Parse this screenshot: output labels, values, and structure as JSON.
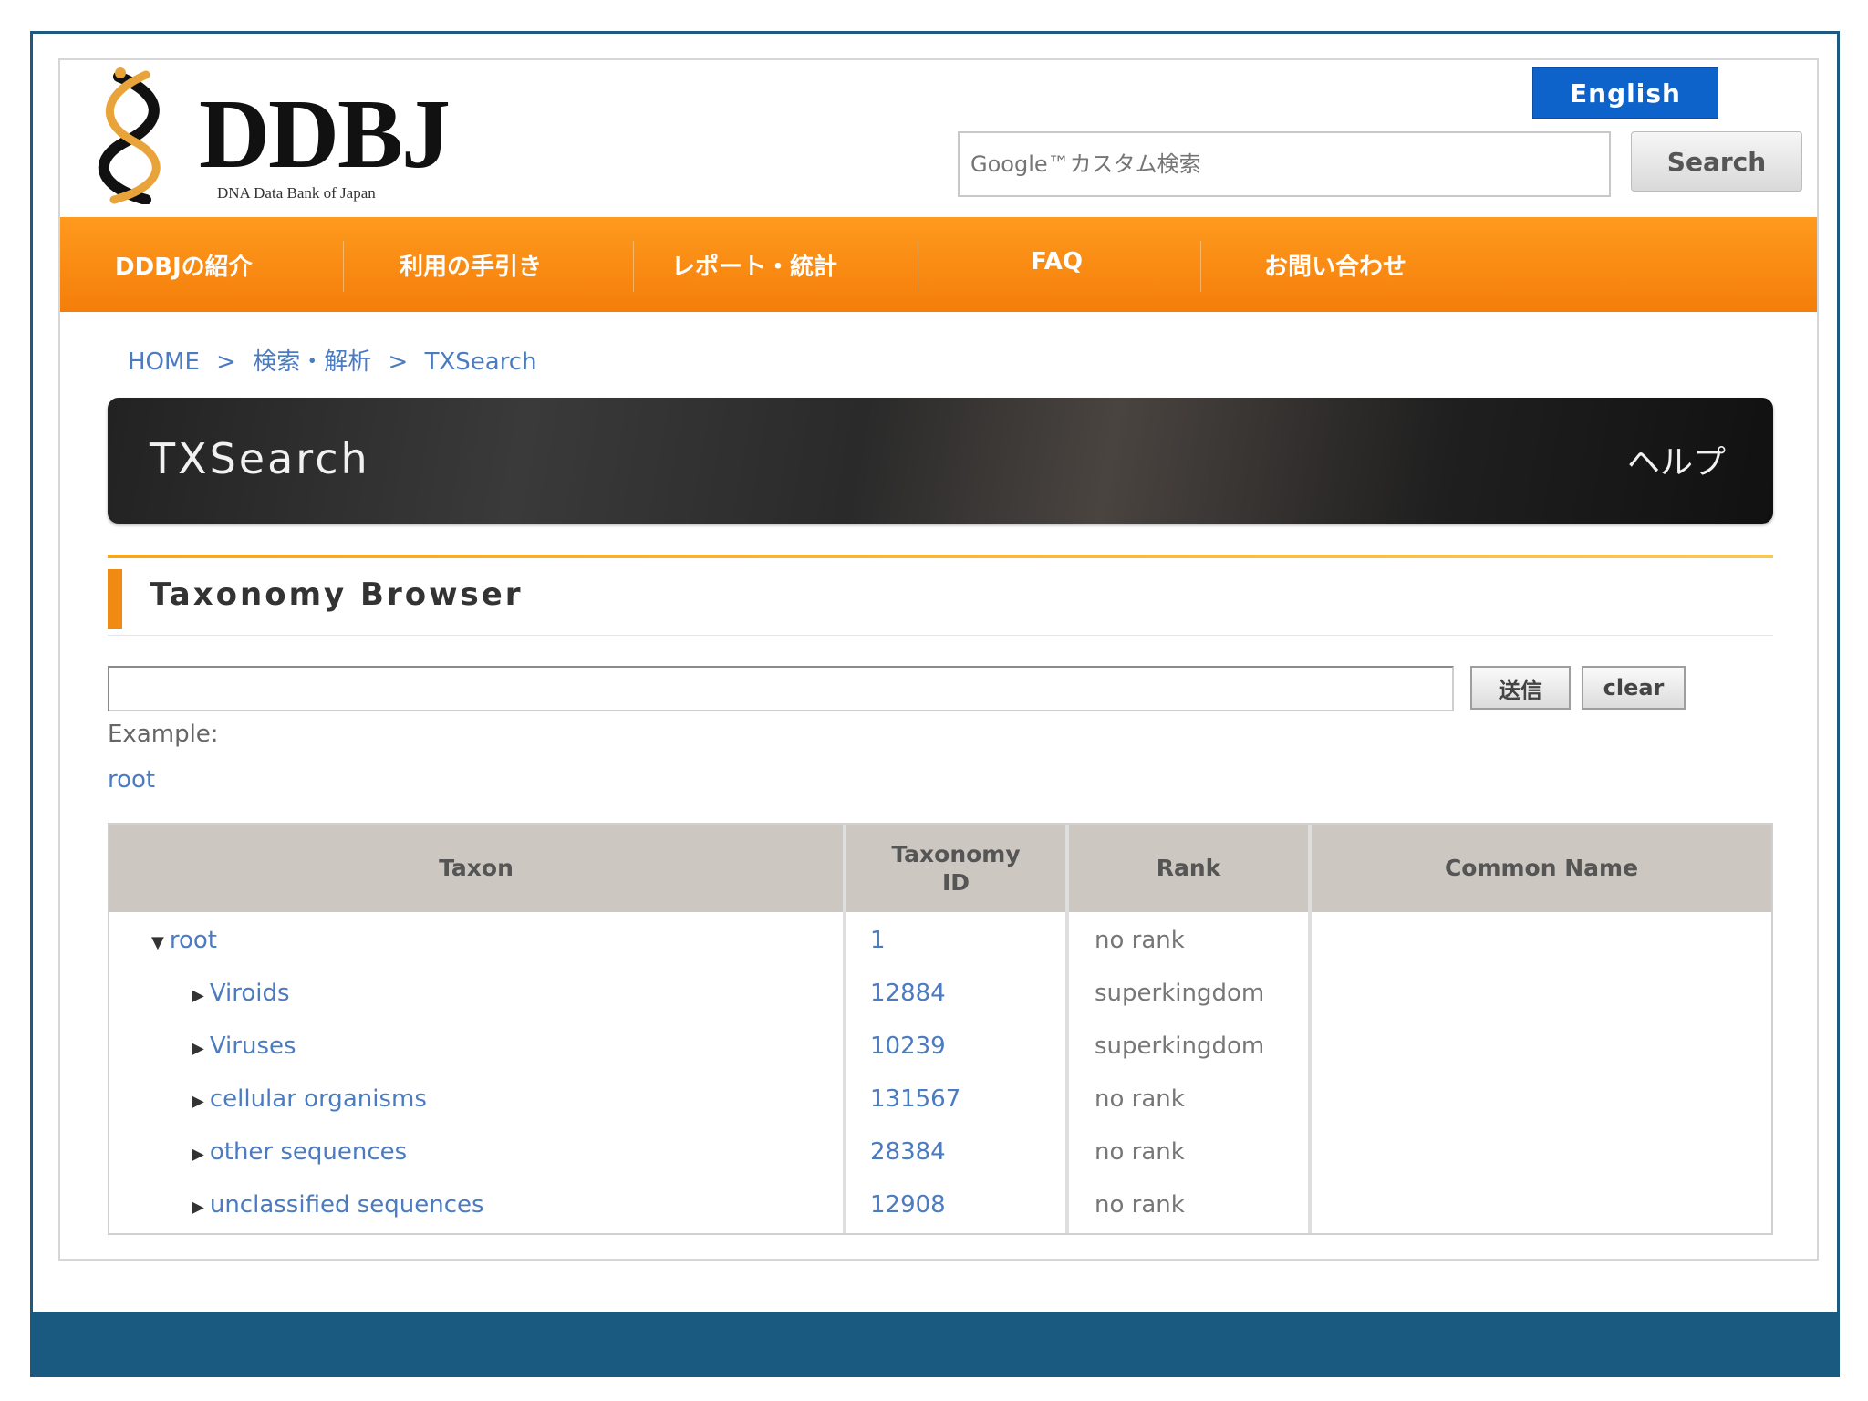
{
  "header": {
    "logo_text": "DDBJ",
    "logo_subtitle": "DNA Data Bank of Japan",
    "english_label": "English",
    "search_placeholder": "Google™カスタム検索",
    "search_button": "Search"
  },
  "nav": {
    "items": [
      {
        "label": "DDBJの紹介"
      },
      {
        "label": "利用の手引き"
      },
      {
        "label": "レポート・統計"
      },
      {
        "label": "FAQ"
      },
      {
        "label": "お問い合わせ"
      }
    ]
  },
  "breadcrumb": {
    "items": [
      "HOME",
      ">",
      "検索・解析",
      ">",
      "TXSearch"
    ]
  },
  "banner": {
    "title": "TXSearch",
    "help": "ヘルプ"
  },
  "section": {
    "title": "Taxonomy Browser"
  },
  "form": {
    "query_value": "",
    "submit_label": "送信",
    "clear_label": "clear",
    "example_label": "Example:",
    "example_link": "root"
  },
  "table": {
    "headers": {
      "taxon": "Taxon",
      "taxonomy_id_line1": "Taxonomy",
      "taxonomy_id_line2": "ID",
      "rank": "Rank",
      "common_name": "Common Name"
    },
    "rows": [
      {
        "taxon": "root",
        "id": "1",
        "rank": "no rank",
        "common_name": ""
      },
      {
        "taxon": "Viroids",
        "id": "12884",
        "rank": "superkingdom",
        "common_name": ""
      },
      {
        "taxon": "Viruses",
        "id": "10239",
        "rank": "superkingdom",
        "common_name": ""
      },
      {
        "taxon": "cellular organisms",
        "id": "131567",
        "rank": "no rank",
        "common_name": ""
      },
      {
        "taxon": "other sequences",
        "id": "28384",
        "rank": "no rank",
        "common_name": ""
      },
      {
        "taxon": "unclassified sequences",
        "id": "12908",
        "rank": "no rank",
        "common_name": ""
      }
    ]
  },
  "colors": {
    "nav_orange": "#f58a12",
    "english_blue": "#0d63c9",
    "frame_blue": "#1b5a80",
    "link_blue": "#4b7bc0"
  }
}
